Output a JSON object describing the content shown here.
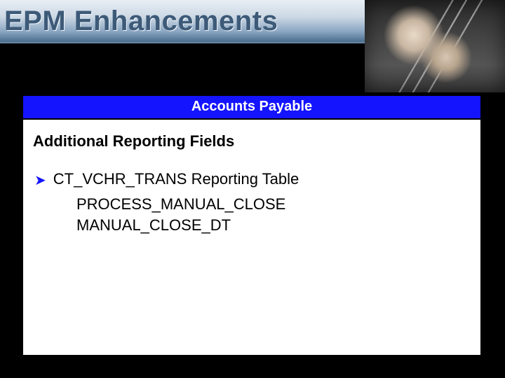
{
  "title": "EPM Enhancements",
  "section_title": "Accounts Payable",
  "subheading": "Additional Reporting Fields",
  "bullet_label": "CT_VCHR_TRANS Reporting Table",
  "fields": [
    "PROCESS_MANUAL_CLOSE",
    "MANUAL_CLOSE_DT"
  ]
}
